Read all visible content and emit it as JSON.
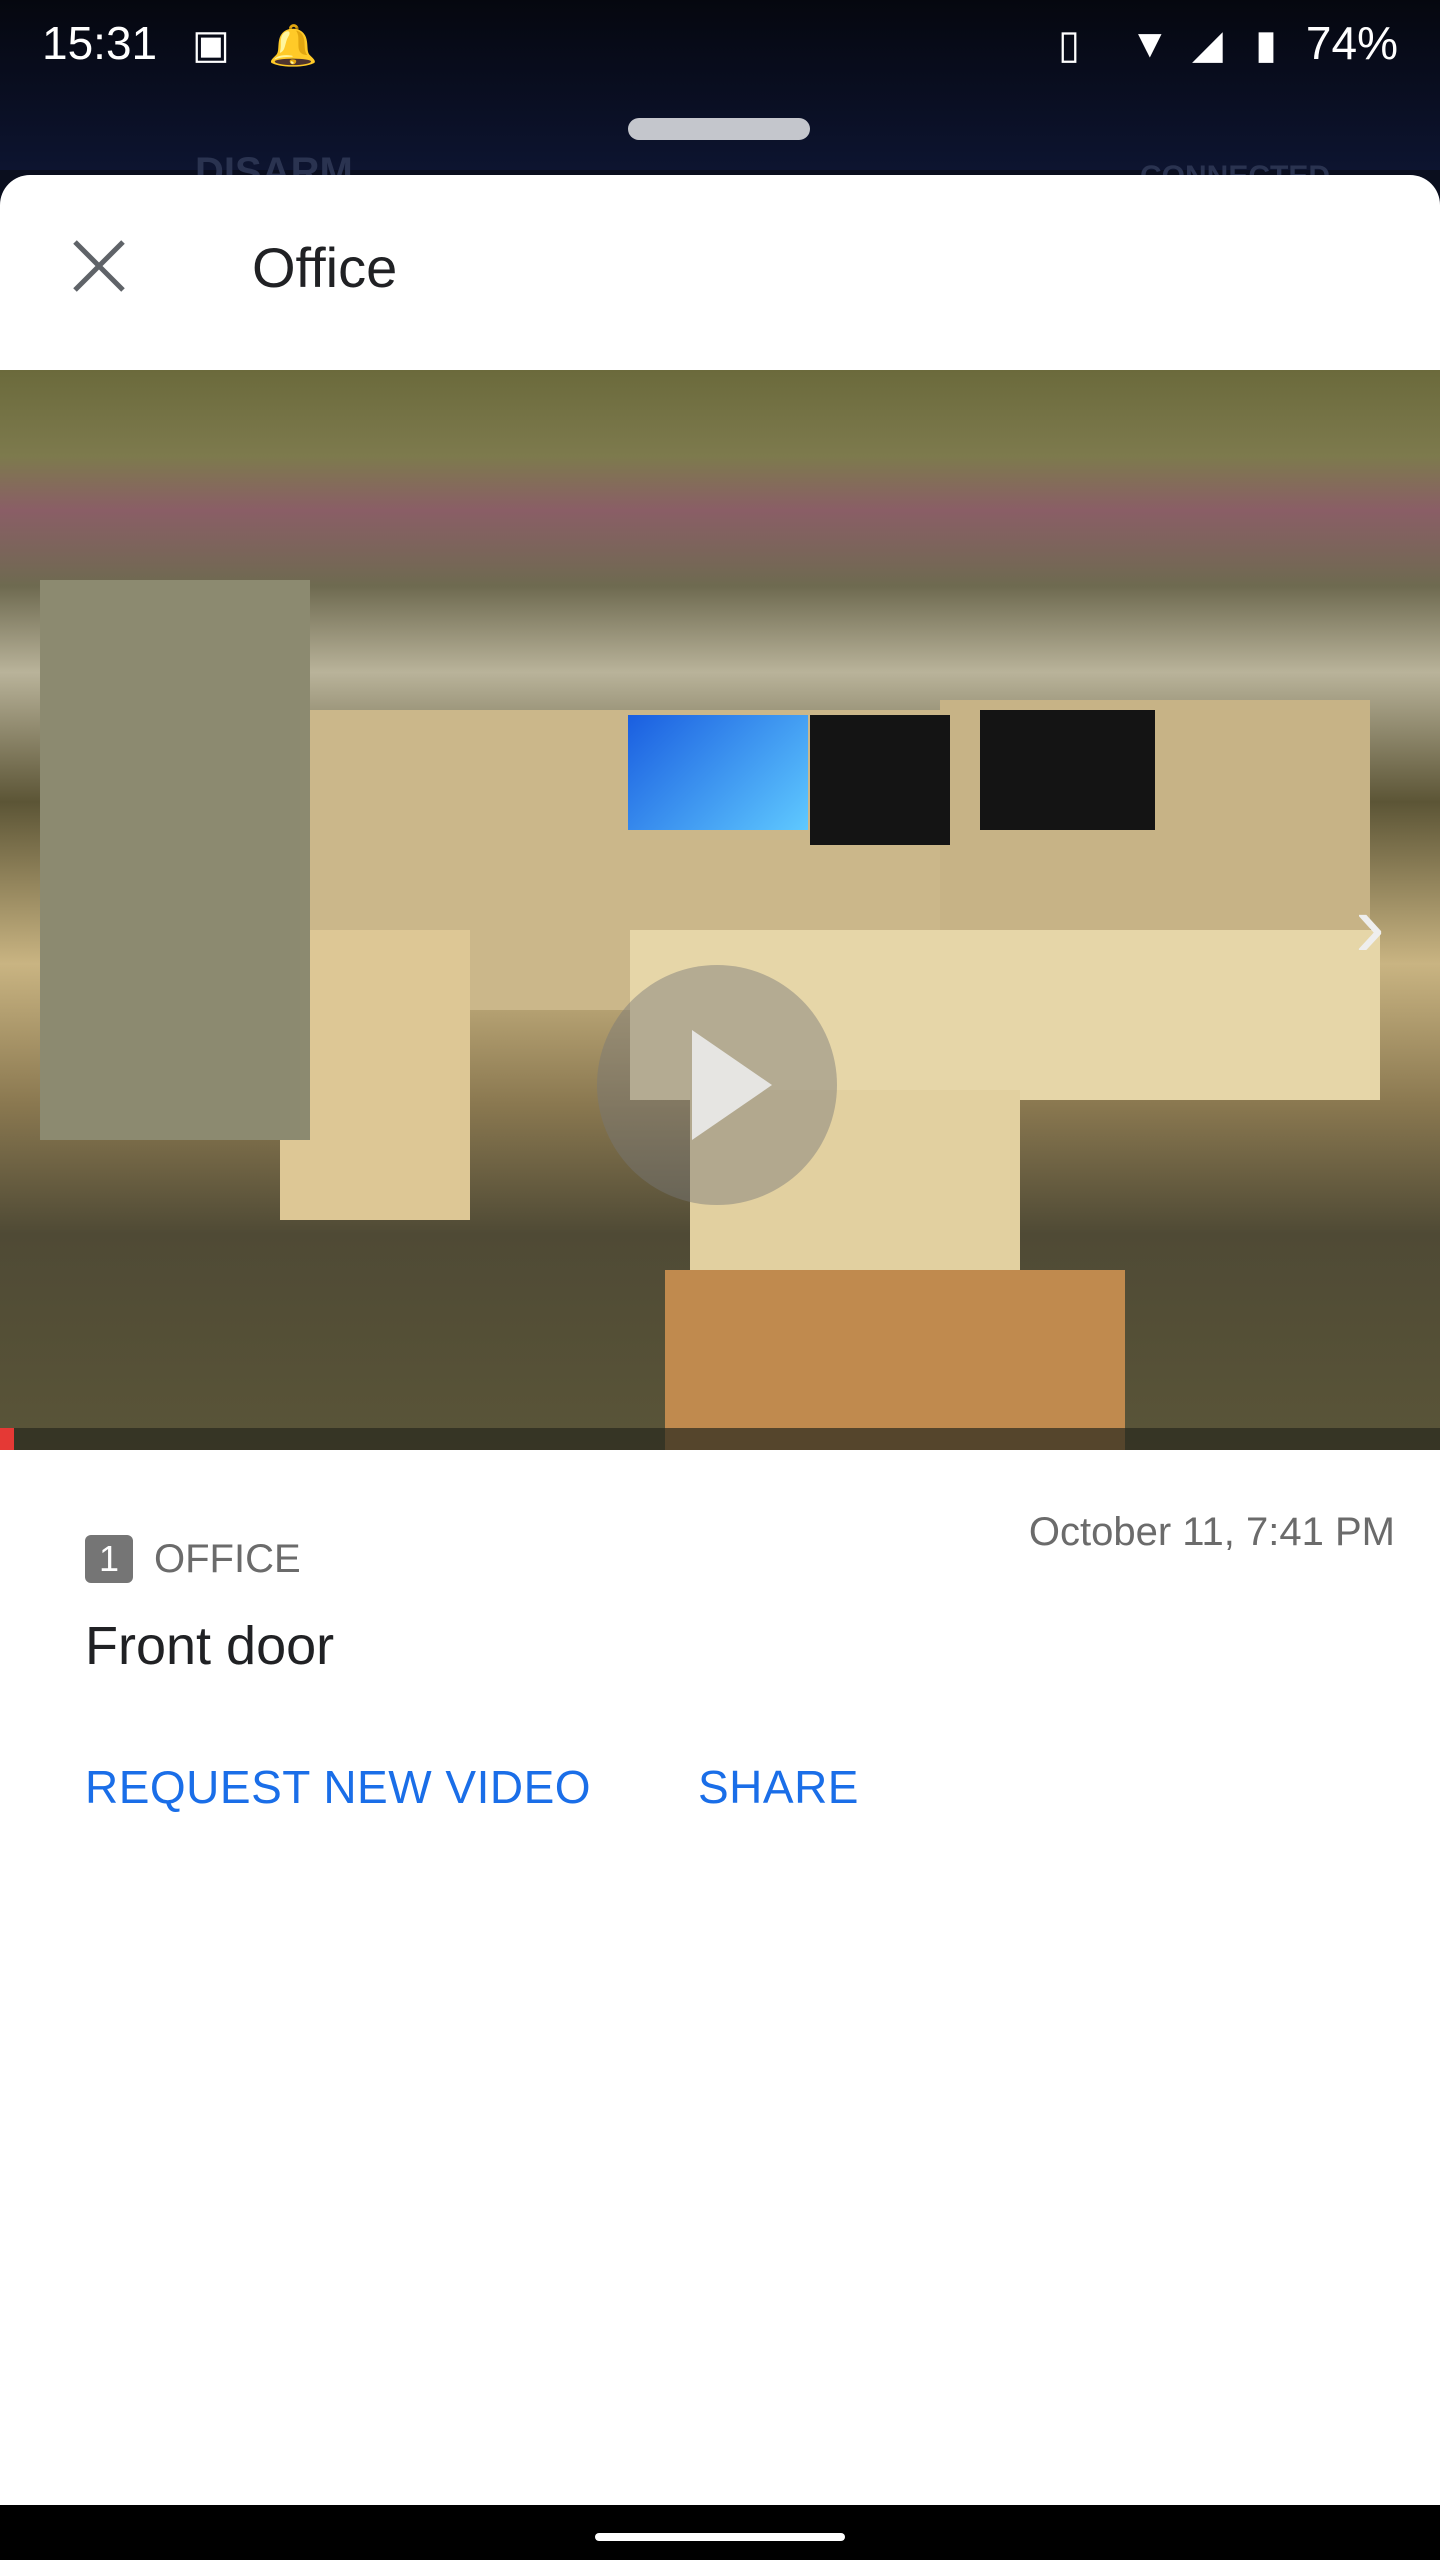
{
  "status_bar": {
    "time": "15:31",
    "battery": "74%",
    "icons": [
      "image-icon",
      "alarm-icon",
      "vibrate-icon",
      "wifi-icon",
      "signal-icon",
      "battery-icon"
    ]
  },
  "background_app": {
    "title": "DISARM",
    "status": "CONNECTED"
  },
  "sheet": {
    "title": "Office"
  },
  "video": {
    "progress_percent": 1,
    "accent": "#e53935"
  },
  "event": {
    "zone_number": "1",
    "zone_name": "OFFICE",
    "timestamp": "October 11, 7:41 PM",
    "label": "Front door"
  },
  "actions": {
    "request_label": "REQUEST NEW VIDEO",
    "share_label": "SHARE",
    "color": "#1a6ee8"
  }
}
